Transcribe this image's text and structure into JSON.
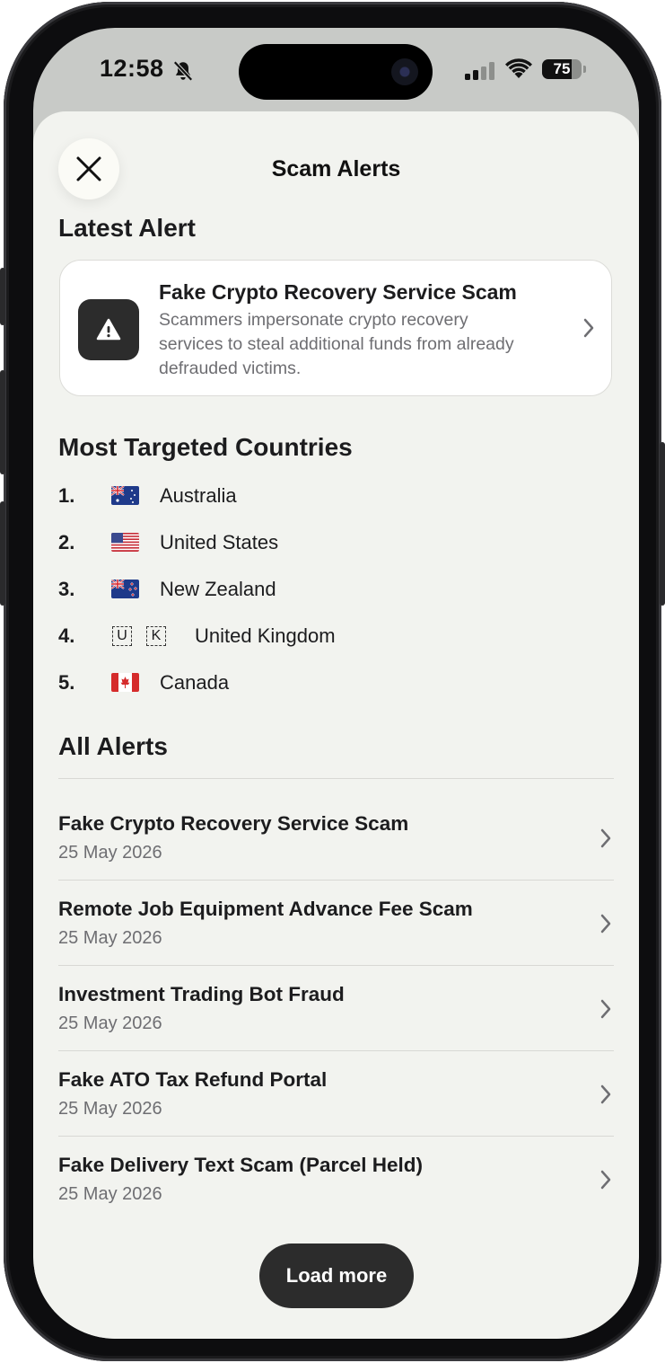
{
  "status_bar": {
    "time": "12:58",
    "battery": "75",
    "icons": [
      "bell-slash-icon",
      "cellular-signal-icon",
      "wifi-icon",
      "battery-icon"
    ]
  },
  "sheet": {
    "title": "Scam Alerts",
    "close_icon": "close-icon"
  },
  "latest_alert": {
    "heading": "Latest Alert",
    "title": "Fake Crypto Recovery Service Scam",
    "description": "Scammers impersonate crypto recovery services to steal additional funds from already defrauded victims.",
    "icon": "warning-icon"
  },
  "countries": {
    "heading": "Most Targeted Countries",
    "items": [
      {
        "rank": "1.",
        "name": "Australia",
        "flag": "AU"
      },
      {
        "rank": "2.",
        "name": "United States",
        "flag": "US"
      },
      {
        "rank": "3.",
        "name": "New Zealand",
        "flag": "NZ"
      },
      {
        "rank": "4.",
        "name": "United Kingdom",
        "flag": "UK",
        "flag_letters": [
          "U",
          "K"
        ]
      },
      {
        "rank": "5.",
        "name": "Canada",
        "flag": "CA"
      }
    ]
  },
  "all_alerts": {
    "heading": "All Alerts",
    "items": [
      {
        "title": "Fake Crypto Recovery Service Scam",
        "date": "25 May 2026"
      },
      {
        "title": "Remote Job Equipment Advance Fee Scam",
        "date": "25 May 2026"
      },
      {
        "title": "Investment Trading Bot Fraud",
        "date": "25 May 2026"
      },
      {
        "title": "Fake ATO Tax Refund Portal",
        "date": "25 May 2026"
      },
      {
        "title": "Fake Delivery Text Scam (Parcel Held)",
        "date": "25 May 2026"
      }
    ],
    "load_more_label": "Load more"
  },
  "colors": {
    "sheet_bg": "#f2f3ef",
    "dark_button": "#2c2c2c",
    "secondary_text": "#6e6e72"
  }
}
